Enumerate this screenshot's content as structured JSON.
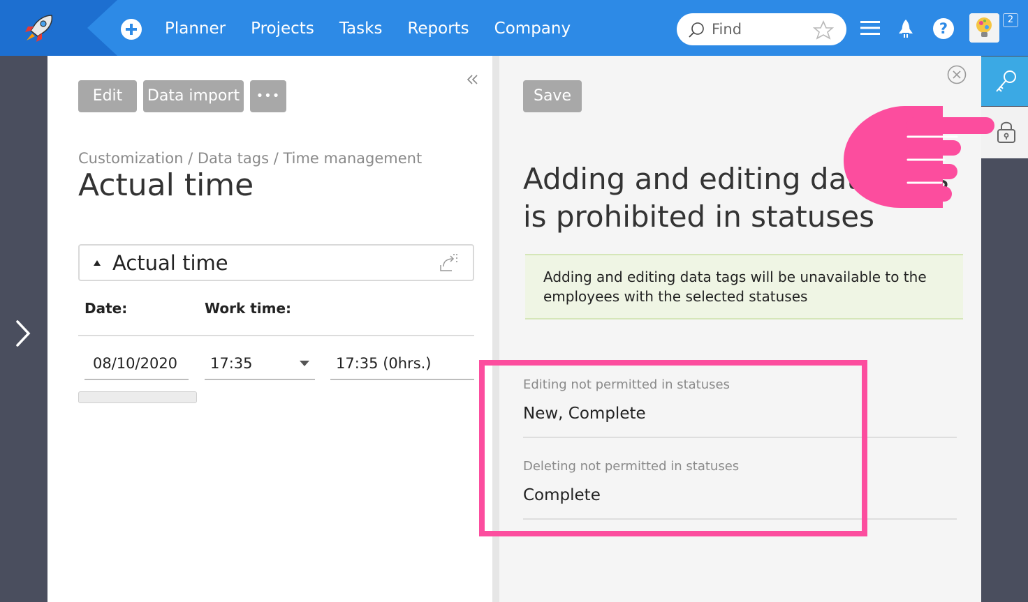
{
  "header": {
    "nav": [
      {
        "label": "Planner",
        "name": "nav-planner"
      },
      {
        "label": "Projects",
        "name": "nav-projects"
      },
      {
        "label": "Tasks",
        "name": "nav-tasks"
      },
      {
        "label": "Reports",
        "name": "nav-reports"
      },
      {
        "label": "Company",
        "name": "nav-company"
      }
    ],
    "search_placeholder": "Find",
    "help_glyph": "?",
    "notification_count": "2"
  },
  "left_panel": {
    "buttons": {
      "edit": "Edit",
      "data_import": "Data import",
      "more": "•••"
    },
    "breadcrumb": "Customization / Data tags / Time management",
    "title": "Actual time",
    "group_title": "Actual time",
    "columns": {
      "date": "Date:",
      "work_time": "Work time:"
    },
    "row": {
      "date": "08/10/2020",
      "time": "17:35",
      "duration": "17:35 (0hrs.)"
    }
  },
  "right_panel": {
    "save_label": "Save",
    "title": "Adding and editing data tags is prohibited in statuses",
    "info": "Adding and editing data tags will be unavailable to the employees with the selected statuses",
    "editing_label": "Editing not permitted in statuses",
    "editing_value": "New, Complete",
    "deleting_label": "Deleting not permitted in statuses",
    "deleting_value": "Complete"
  },
  "colors": {
    "topbar": "#2d8ae6",
    "topbar_dark": "#1d6fd0",
    "sidebar": "#4a4e5e",
    "button_gray": "#a8a8a8",
    "highlight": "#fc4d9e",
    "rail_active": "#3ba9e4",
    "info_bg": "#eff5e4"
  },
  "icons": {
    "logo": "rocket-logo-icon",
    "add": "plus-circle-icon",
    "search": "search-icon",
    "favorite": "star-icon",
    "menu": "hamburger-menu-icon",
    "rocket": "rocket-icon",
    "help": "question-icon",
    "collapse": "double-chevron-left-icon",
    "expand": "chevron-right-icon",
    "close": "close-circle-icon",
    "key": "key-icon",
    "lock": "lock-icon"
  }
}
